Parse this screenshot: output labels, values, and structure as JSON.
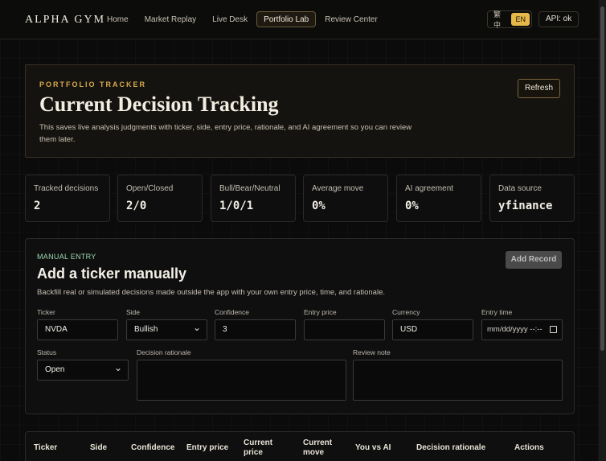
{
  "brand": "ALPHA GYM",
  "nav": [
    {
      "label": "Home",
      "active": false
    },
    {
      "label": "Market Replay",
      "active": false
    },
    {
      "label": "Live Desk",
      "active": false
    },
    {
      "label": "Portfolio Lab",
      "active": true
    },
    {
      "label": "Review Center",
      "active": false
    }
  ],
  "lang": {
    "zh": "繁中",
    "en": "EN",
    "selected": "EN"
  },
  "api_status": "API: ok",
  "hero": {
    "kicker": "PORTFOLIO TRACKER",
    "title": "Current Decision Tracking",
    "description": "This saves live analysis judgments with ticker, side, entry price, rationale, and AI agreement so you can review them later.",
    "refresh_label": "Refresh"
  },
  "stats": [
    {
      "label": "Tracked decisions",
      "value": "2"
    },
    {
      "label": "Open/Closed",
      "value": "2/0"
    },
    {
      "label": "Bull/Bear/Neutral",
      "value": "1/0/1"
    },
    {
      "label": "Average move",
      "value": "0%"
    },
    {
      "label": "AI agreement",
      "value": "0%"
    },
    {
      "label": "Data source",
      "value": "yfinance"
    }
  ],
  "manual": {
    "kicker": "MANUAL ENTRY",
    "title": "Add a ticker manually",
    "description": "Backfill real or simulated decisions made outside the app with your own entry price, time, and rationale.",
    "add_label": "Add Record",
    "fields": {
      "ticker": {
        "label": "Ticker",
        "value": "NVDA"
      },
      "side": {
        "label": "Side",
        "value": "Bullish"
      },
      "confidence": {
        "label": "Confidence",
        "value": "3"
      },
      "entry_price": {
        "label": "Entry price",
        "value": ""
      },
      "currency": {
        "label": "Currency",
        "value": "USD"
      },
      "entry_time": {
        "label": "Entry time",
        "placeholder": "mm/dd/yyyy --:--"
      },
      "status": {
        "label": "Status",
        "value": "Open"
      },
      "rationale": {
        "label": "Decision rationale"
      },
      "review_note": {
        "label": "Review note"
      }
    }
  },
  "table": {
    "columns": [
      "Ticker",
      "Side",
      "Confidence",
      "Entry price",
      "Current price",
      "Current move",
      "You vs AI",
      "Decision rationale",
      "Actions"
    ]
  }
}
